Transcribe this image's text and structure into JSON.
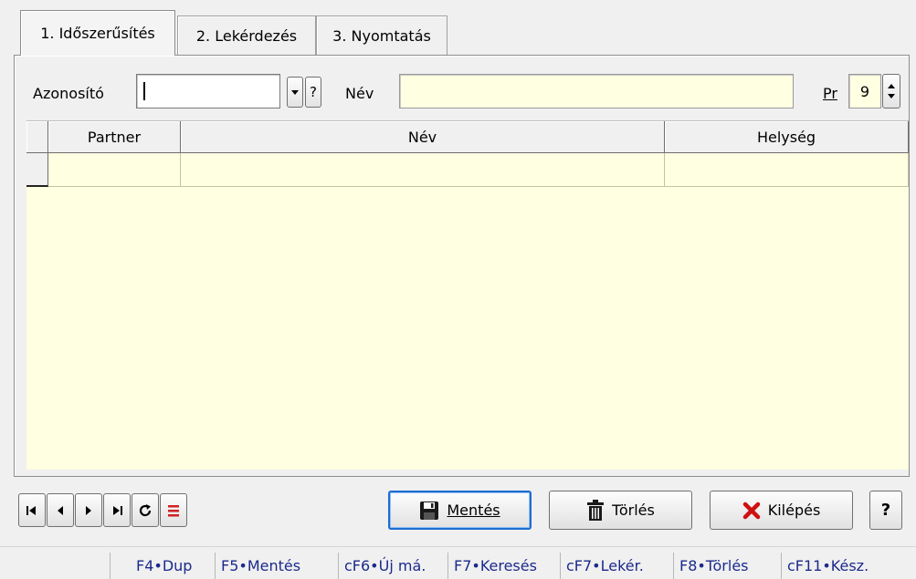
{
  "tabs": [
    {
      "label": "1. Időszerűsítés"
    },
    {
      "label": "2. Lekérdezés"
    },
    {
      "label": "3. Nyomtatás"
    }
  ],
  "form": {
    "azonosito_label": "Azonosító",
    "azonosito_value": "",
    "question_mark": "?",
    "nev_label": "Név",
    "nev_value": "",
    "pr_label": "Pr",
    "pr_value": "9"
  },
  "grid": {
    "columns": [
      "Partner",
      "Név",
      "Helység"
    ],
    "rows": [
      [
        "",
        "",
        ""
      ]
    ]
  },
  "buttons": {
    "save": "Mentés",
    "delete": "Törlés",
    "exit": "Kilépés",
    "help": "?"
  },
  "statusbar": [
    "F4•Dup",
    "F5•Mentés",
    "cF6•Új má.",
    "F7•Keresés",
    "cF7•Lekér.",
    "F8•Törlés",
    "cF11•Kész."
  ],
  "colors": {
    "field_yellow": "#ffffe1",
    "delete_red": "#d01010",
    "status_text": "#1b2a8c",
    "default_button_border": "#1e6cd0"
  }
}
